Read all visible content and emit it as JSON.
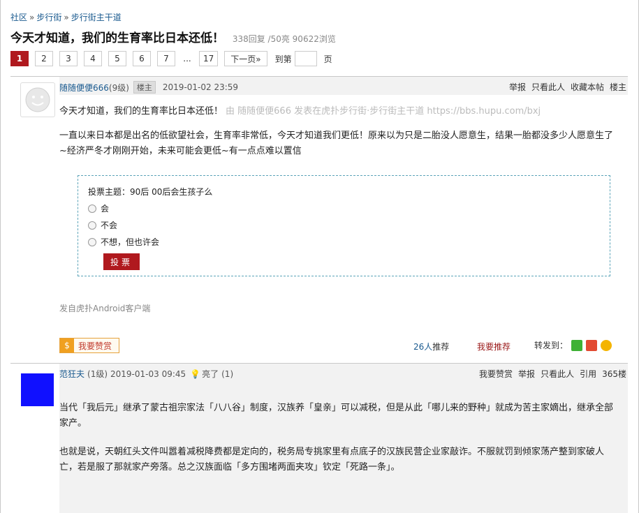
{
  "breadcrumb": {
    "items": [
      "社区",
      "步行街",
      "步行街主干道"
    ],
    "sep": "»"
  },
  "thread": {
    "title": "今天才知道，我们的生育率比日本还低！",
    "meta": "338回复 /50亮  90622浏览"
  },
  "pager": {
    "pages": [
      "1",
      "2",
      "3",
      "4",
      "5",
      "6",
      "7"
    ],
    "dots": "...",
    "last": "17",
    "next": "下一页»",
    "goto_label": "到第",
    "page_label": "页"
  },
  "post1": {
    "author": "随随便便666",
    "level": "(9级)",
    "host_badge": "楼主",
    "time": "2019-01-02 23:59",
    "actions": [
      "举报",
      "只看此人",
      "收藏本帖",
      "楼主"
    ],
    "line1": "今天才知道，我们的生育率比日本还低！",
    "signature": "由  随随便便666 发表在虎扑步行街·步行街主干道 https://bbs.hupu.com/bxj",
    "body": "一直以来日本都是出名的低欲望社会，生育率非常低，今天才知道我们更低！原来以为只是二胎没人愿意生，结果一胎都没多少人愿意生了~经济严冬才刚刚开始，未来可能会更低~有一点点难以置信",
    "poll": {
      "title": "投票主题：90后 00后会生孩子么",
      "options": [
        "会",
        "不会",
        "不想，但也许会"
      ],
      "vote_label": "投票"
    },
    "client": "发自虎扑Android客户端",
    "tip_label": "我要赞赏",
    "recommend_count": "26人",
    "recommend_suffix": "推荐",
    "recommend_btn": "我要推荐",
    "share_label": "转发到："
  },
  "post2": {
    "author": "范狂夫",
    "level": "(1级)",
    "time": "2019-01-03 09:45",
    "light": "亮了",
    "light_count": "(1)",
    "actions": [
      "我要赞赏",
      "举报",
      "只看此人",
      "引用",
      "365楼"
    ],
    "para1": "当代「我后元」继承了蒙古祖宗家法「八八谷」制度，汉族养「皇亲」可以减税，但是从此「哪儿来的野种」就成为苦主家嫡出，继承全部家产。",
    "para2": "也就是说，天朝红头文件叫嚣着减税降费都是定向的，税务局专挑家里有点底子的汉族民营企业家敲诈。不服就罚到倾家荡产整到家破人亡，若是服了那就家产旁落。总之汉族面临「多方围堵两面夹攻」钦定「死路一条」。"
  }
}
